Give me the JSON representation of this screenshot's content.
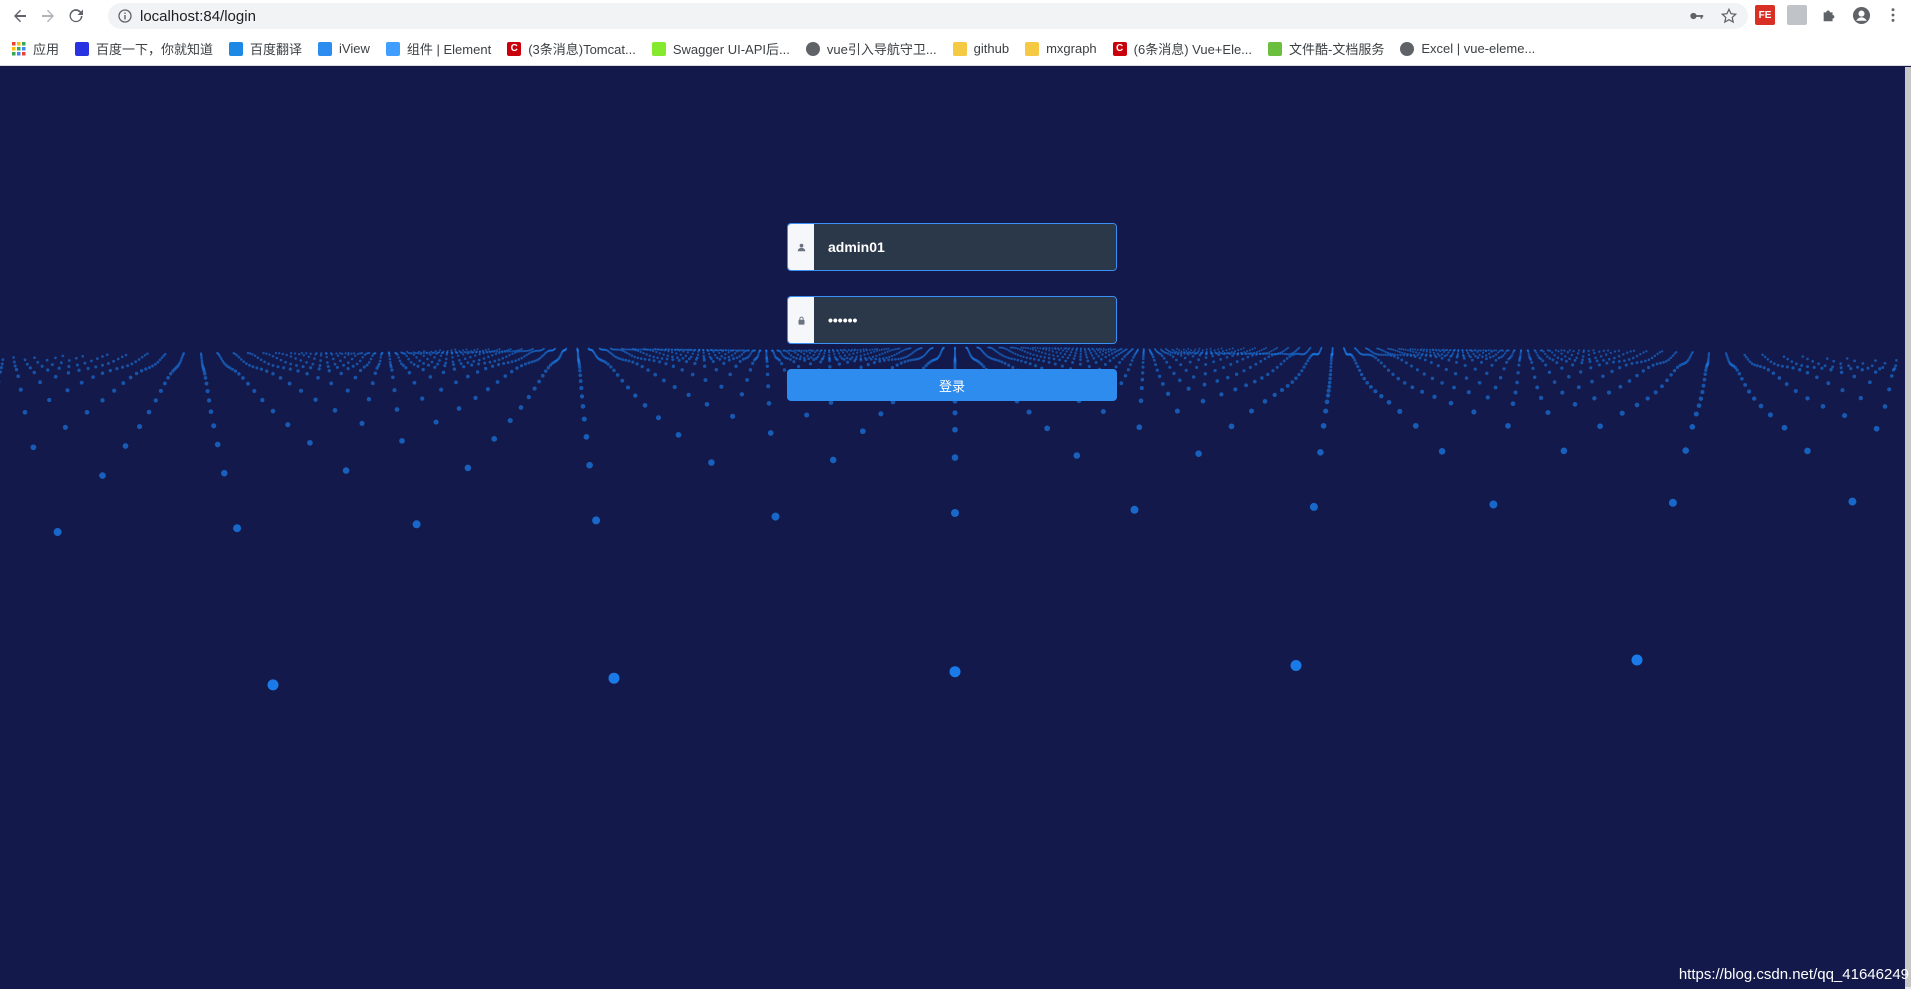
{
  "browser": {
    "url": "localhost:84/login",
    "bookmarks": [
      {
        "label": "应用",
        "icon": "apps-grid-icon",
        "color": "#ea4335"
      },
      {
        "label": "百度一下，你就知道",
        "icon": "baidu-paw-icon",
        "color": "#2932e1"
      },
      {
        "label": "百度翻译",
        "icon": "baidu-translate-icon",
        "color": "#1e88e5"
      },
      {
        "label": "iView",
        "icon": "iview-icon",
        "color": "#2d8cf0"
      },
      {
        "label": "组件 | Element",
        "icon": "element-icon",
        "color": "#409eff"
      },
      {
        "label": "(3条消息)Tomcat...",
        "icon": "csdn-icon",
        "color": "#c9000c"
      },
      {
        "label": "Swagger UI-API后...",
        "icon": "swagger-icon",
        "color": "#85ea2d"
      },
      {
        "label": "vue引入导航守卫...",
        "icon": "globe-icon",
        "color": "#5f6368"
      },
      {
        "label": "github",
        "icon": "folder-icon",
        "color": "#f6c945"
      },
      {
        "label": "mxgraph",
        "icon": "folder-icon",
        "color": "#f6c945"
      },
      {
        "label": "(6条消息) Vue+Ele...",
        "icon": "csdn-icon",
        "color": "#c9000c"
      },
      {
        "label": "文件酷-文档服务",
        "icon": "wenjianku-icon",
        "color": "#6cbf3e"
      },
      {
        "label": "Excel | vue-eleme...",
        "icon": "globe-icon",
        "color": "#5f6368"
      }
    ]
  },
  "login": {
    "username": "admin01",
    "password": "admin1",
    "button_label": "登录",
    "accent": "#2f8cef",
    "background": "#13194a"
  },
  "watermark": "https://blog.csdn.net/qq_41646249"
}
